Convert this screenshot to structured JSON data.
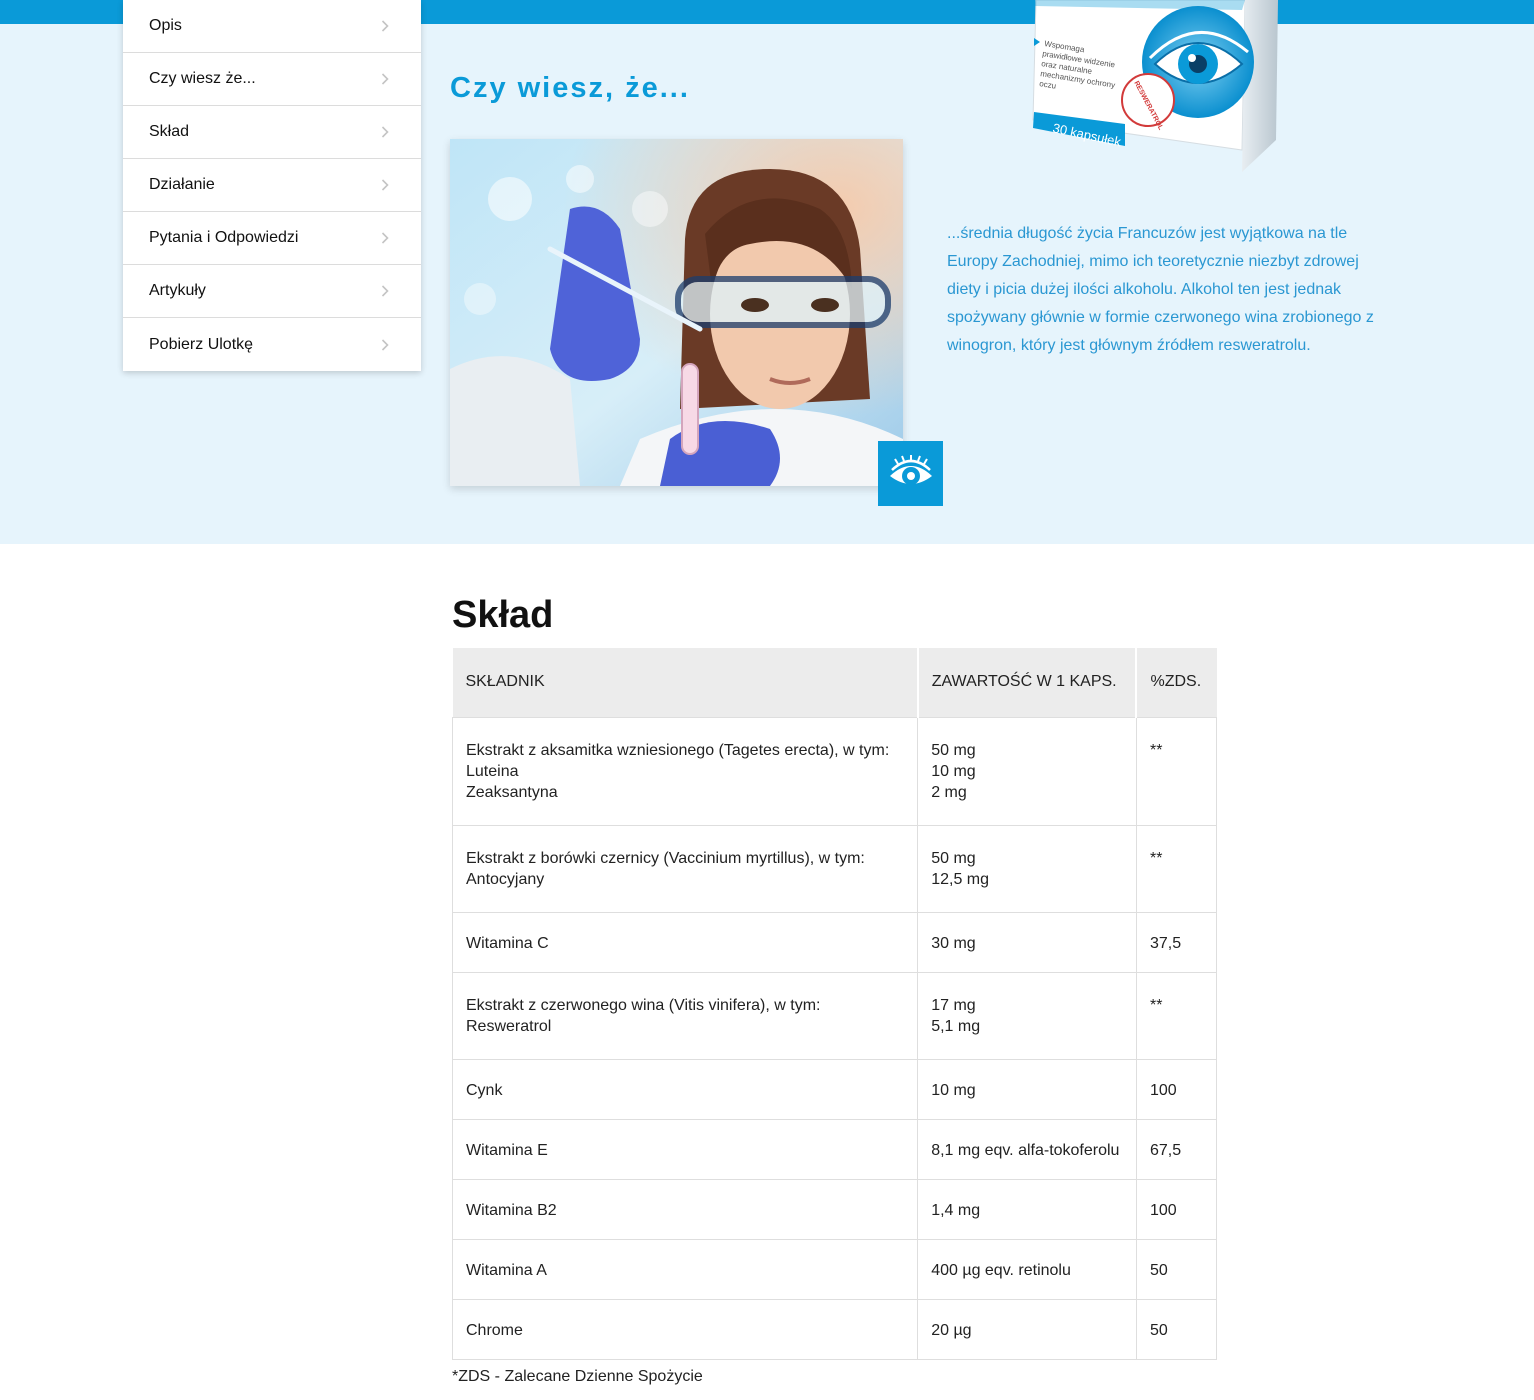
{
  "menu": {
    "items": [
      {
        "label": "Opis"
      },
      {
        "label": "Czy wiesz że..."
      },
      {
        "label": "Skład"
      },
      {
        "label": "Działanie"
      },
      {
        "label": "Pytania i Odpowiedzi"
      },
      {
        "label": "Artykuły"
      },
      {
        "label": "Pobierz Ulotkę"
      }
    ]
  },
  "hero": {
    "title": "Czy wiesz, że...",
    "text": "...średnia długość życia Francuzów jest wyjątkowa na tle Europy Zachodniej, mimo ich teoretycznie niezbyt zdrowej diety i picia dużej ilości alkoholu. Alkohol ten jest jednak spożywany głównie w formie czerwonego wina zrobionego z winogron, który jest głównym źródłem resweratrolu.",
    "product_box": {
      "text_lines": [
        "Wspomaga",
        "prawidłowe widzenie",
        "oraz naturalne",
        "mechanizmy ochrony",
        "oczu"
      ],
      "capsules": "30 kapsułek",
      "seal": "RESWERATROL"
    }
  },
  "sklad": {
    "title": "Skład",
    "headers": [
      "SKŁADNIK",
      "ZAWARTOŚĆ W 1 KAPS.",
      "%ZDS."
    ],
    "rows": [
      {
        "ingredient": [
          "Ekstrakt z aksamitka wzniesionego (Tagetes erecta), w tym:",
          "Luteina",
          "Zeaksantyna"
        ],
        "content": [
          "50 mg",
          "10 mg",
          "2 mg"
        ],
        "zds": "**"
      },
      {
        "ingredient": [
          "Ekstrakt z borówki czernicy (Vaccinium myrtillus), w tym:",
          "Antocyjany"
        ],
        "content": [
          "50 mg",
          "12,5 mg"
        ],
        "zds": "**"
      },
      {
        "ingredient": [
          "Witamina C"
        ],
        "content": [
          "30 mg"
        ],
        "zds": "37,5"
      },
      {
        "ingredient": [
          "Ekstrakt z czerwonego wina (Vitis vinifera), w tym:",
          "Resweratrol"
        ],
        "content": [
          "17 mg",
          "5,1 mg"
        ],
        "zds": "**"
      },
      {
        "ingredient": [
          "Cynk"
        ],
        "content": [
          "10 mg"
        ],
        "zds": "100"
      },
      {
        "ingredient": [
          "Witamina E"
        ],
        "content": [
          "8,1 mg eqv. alfa-tokoferolu"
        ],
        "zds": "67,5"
      },
      {
        "ingredient": [
          "Witamina B2"
        ],
        "content": [
          "1,4 mg"
        ],
        "zds": "100"
      },
      {
        "ingredient": [
          "Witamina A"
        ],
        "content": [
          "400 µg eqv. retinolu"
        ],
        "zds": "50"
      },
      {
        "ingredient": [
          "Chrome"
        ],
        "content": [
          "20 µg"
        ],
        "zds": "50"
      }
    ],
    "footnote": "*ZDS - Zalecane Dzienne Spożycie"
  },
  "colors": {
    "accent": "#0a9ad8",
    "hero_bg": "#e6f4fc",
    "text_blue": "#2a97d2",
    "table_header_bg": "#ececec"
  },
  "icons": [
    "chevron-right-icon",
    "eye-icon"
  ]
}
